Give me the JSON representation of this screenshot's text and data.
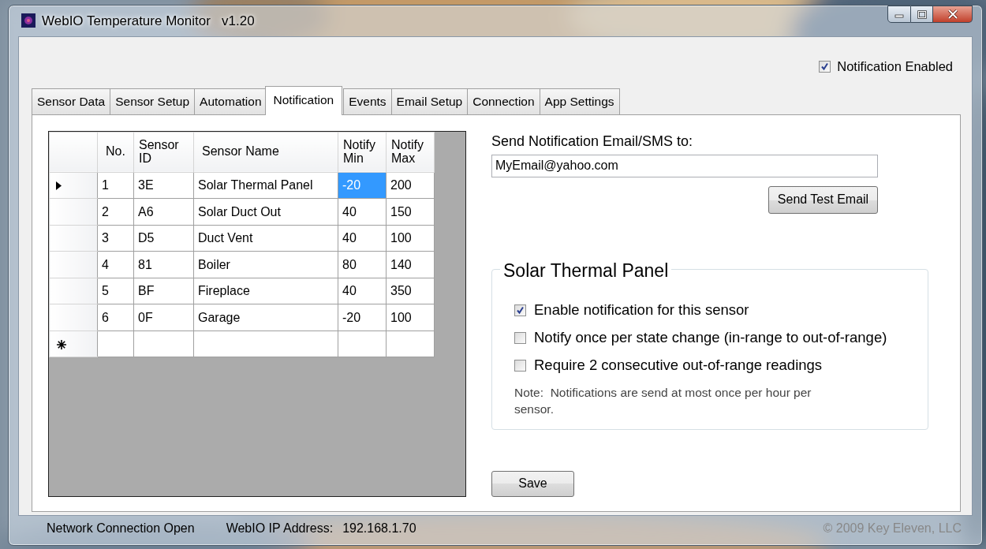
{
  "window": {
    "title": "WebIO Temperature Monitor   v1.20"
  },
  "notification_enabled": {
    "label": "Notification Enabled",
    "checked": true
  },
  "tabs": [
    {
      "label": "Sensor Data",
      "selected": false
    },
    {
      "label": "Sensor Setup",
      "selected": false
    },
    {
      "label": "Automation",
      "selected": false
    },
    {
      "label": "Notification",
      "selected": true
    },
    {
      "label": "Events",
      "selected": false
    },
    {
      "label": "Email Setup",
      "selected": false
    },
    {
      "label": "Connection",
      "selected": false
    },
    {
      "label": "App Settings",
      "selected": false
    }
  ],
  "grid": {
    "columns": [
      "No.",
      "Sensor ID",
      "Sensor Name",
      "Notify Min",
      "Notify Max"
    ],
    "rows": [
      {
        "current": true,
        "cells": [
          {
            "text": "1",
            "selected": false
          },
          {
            "text": "3E",
            "selected": false
          },
          {
            "text": "Solar Thermal Panel",
            "selected": false
          },
          {
            "text": "-20",
            "selected": true
          },
          {
            "text": "200",
            "selected": false
          }
        ]
      },
      {
        "current": false,
        "cells": [
          {
            "text": "2",
            "selected": false
          },
          {
            "text": "A6",
            "selected": false
          },
          {
            "text": "Solar Duct Out",
            "selected": false
          },
          {
            "text": "40",
            "selected": false
          },
          {
            "text": "150",
            "selected": false
          }
        ]
      },
      {
        "current": false,
        "cells": [
          {
            "text": "3",
            "selected": false
          },
          {
            "text": "D5",
            "selected": false
          },
          {
            "text": "Duct Vent",
            "selected": false
          },
          {
            "text": "40",
            "selected": false
          },
          {
            "text": "100",
            "selected": false
          }
        ]
      },
      {
        "current": false,
        "cells": [
          {
            "text": "4",
            "selected": false
          },
          {
            "text": "81",
            "selected": false
          },
          {
            "text": "Boiler",
            "selected": false
          },
          {
            "text": "80",
            "selected": false
          },
          {
            "text": "140",
            "selected": false
          }
        ]
      },
      {
        "current": false,
        "cells": [
          {
            "text": "5",
            "selected": false
          },
          {
            "text": "BF",
            "selected": false
          },
          {
            "text": "Fireplace",
            "selected": false
          },
          {
            "text": "40",
            "selected": false
          },
          {
            "text": "350",
            "selected": false
          }
        ]
      },
      {
        "current": false,
        "cells": [
          {
            "text": "6",
            "selected": false
          },
          {
            "text": "0F",
            "selected": false
          },
          {
            "text": "Garage",
            "selected": false
          },
          {
            "text": "-20",
            "selected": false
          },
          {
            "text": "100",
            "selected": false
          }
        ]
      }
    ],
    "new_row": true
  },
  "email": {
    "label": "Send Notification Email/SMS to:",
    "value": "MyEmail@yahoo.com",
    "button": "Send Test Email"
  },
  "sensor_group": {
    "title": "Solar Thermal Panel",
    "options": [
      {
        "label": "Enable notification for this sensor",
        "checked": true
      },
      {
        "label": "Notify once per state change (in-range to out-of-range)",
        "checked": false
      },
      {
        "label": "Require 2 consecutive out-of-range readings",
        "checked": false
      }
    ],
    "note": "Note:  Notifications are send at most once per hour per sensor."
  },
  "save_button": "Save",
  "status_bar": {
    "connection": "Network Connection Open",
    "ip_label": "WebIO IP Address:",
    "ip_value": "192.168.1.70",
    "copyright": "© 2009 Key Eleven, LLC"
  }
}
